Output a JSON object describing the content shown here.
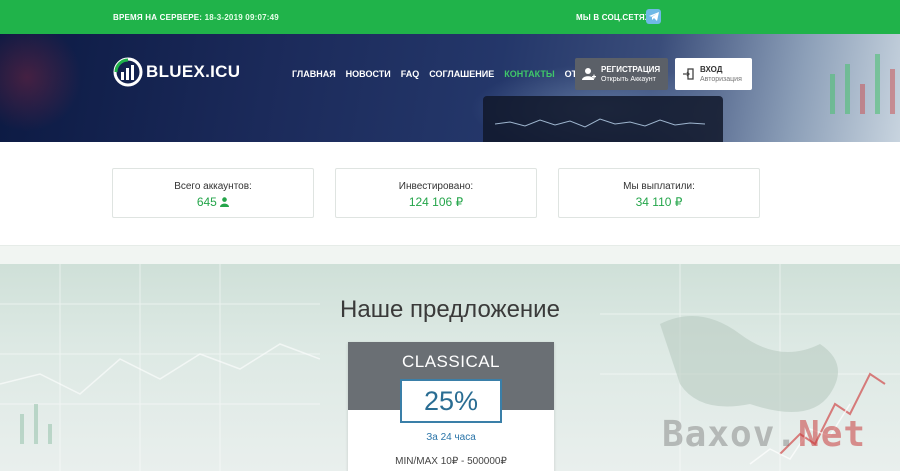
{
  "topbar": {
    "server_label": "ВРЕМЯ НА СЕРВЕРЕ:",
    "server_time": "18-3-2019 09:07:49",
    "social_label": "МЫ В СОЦ.СЕТЯХ:",
    "social_icon": "telegram-icon"
  },
  "header": {
    "logo_text": "BLUEX.ICU",
    "nav": [
      "ГЛАВНАЯ",
      "НОВОСТИ",
      "FAQ",
      "СОГЛАШЕНИЕ",
      "КОНТАКТЫ",
      "ОТЗЫВЫ"
    ],
    "active_nav": "КОНТАКТЫ",
    "register": {
      "title": "РЕГИСТРАЦИЯ",
      "subtitle": "Открыть Аккаунт"
    },
    "login": {
      "title": "ВХОД",
      "subtitle": "Авторизация"
    }
  },
  "stats": [
    {
      "label": "Всего аккаунтов:",
      "value": "645"
    },
    {
      "label": "Инвестировано:",
      "value": "124 106 ₽"
    },
    {
      "label": "Мы выплатили:",
      "value": "34 110 ₽"
    }
  ],
  "offer": {
    "title": "Наше предложение",
    "plan": {
      "name": "CLASSICAL",
      "percent": "25%",
      "period": "За 24 часа",
      "minmax": "MIN/MAX 10₽ - 500000₽"
    }
  },
  "watermark": {
    "main": "Baxov.",
    "suffix": "Net"
  },
  "colors": {
    "accent": "#20b34a",
    "nav_active": "#3fc769",
    "stat_value": "#24a54a",
    "plan_head": "#6a6f74",
    "plan_blue": "#2a6d93"
  }
}
